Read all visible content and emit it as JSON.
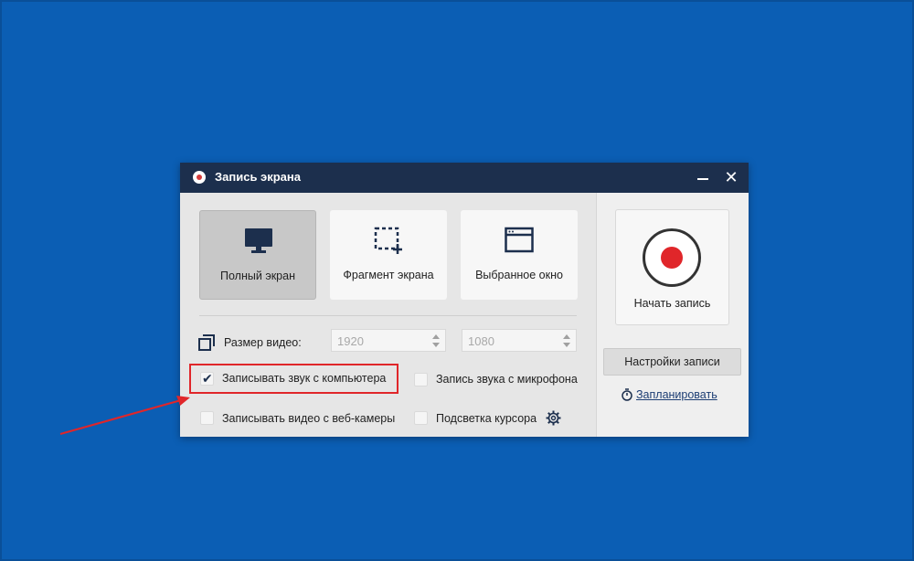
{
  "window": {
    "title": "Запись экрана",
    "minimize_label": "_",
    "close_label": "✕"
  },
  "modes": [
    {
      "label": "Полный экран",
      "icon": "monitor-icon",
      "active": true
    },
    {
      "label": "Фрагмент экрана",
      "icon": "select-area-icon",
      "active": false
    },
    {
      "label": "Выбранное окно",
      "icon": "window-icon",
      "active": false
    }
  ],
  "video_size": {
    "label": "Размер видео:",
    "width": "1920",
    "height": "1080"
  },
  "options": {
    "record_system_audio": {
      "label": "Записывать звук с компьютера",
      "checked": true
    },
    "record_mic": {
      "label": "Запись звука с микрофона",
      "checked": false
    },
    "record_webcam": {
      "label": "Записывать видео с веб-камеры",
      "checked": false
    },
    "cursor_highlight": {
      "label": "Подсветка курсора",
      "checked": false
    }
  },
  "right_pane": {
    "start_label": "Начать запись",
    "settings_label": "Настройки записи",
    "schedule_label": "Запланировать"
  },
  "colors": {
    "desktop": "#0b5eb4",
    "titlebar": "#1c2f4d",
    "record_red": "#e0262a",
    "annotation_red": "#e0262a"
  }
}
